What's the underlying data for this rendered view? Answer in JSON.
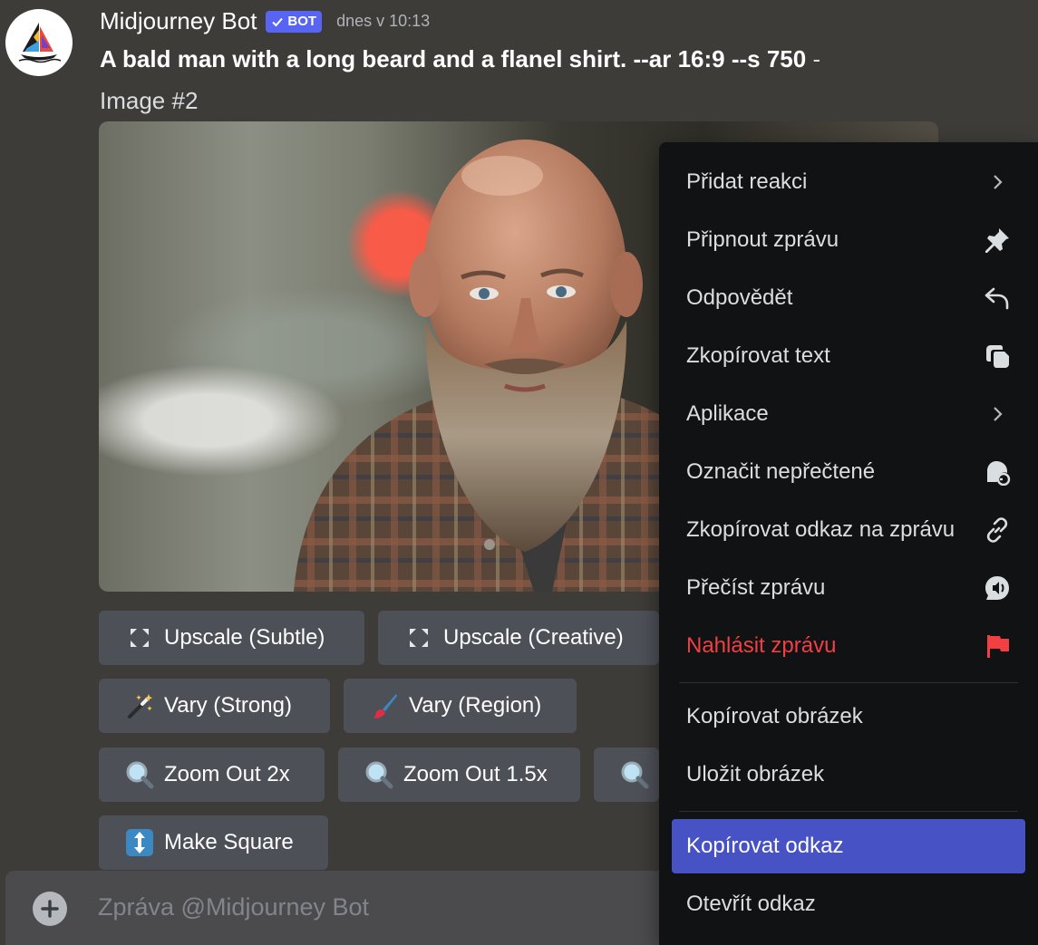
{
  "message": {
    "author": "Midjourney Bot",
    "badge": "BOT",
    "timestamp": "dnes v 10:13",
    "prompt_bold": "A bald man with a long beard and a flanel shirt. --ar 16:9 --s 750",
    "prompt_suffix": " -",
    "image_label": "Image #2"
  },
  "buttons": {
    "upscale_subtle": "Upscale (Subtle)",
    "upscale_creative": "Upscale (Creative)",
    "vary_strong": "Vary (Strong)",
    "vary_region": "Vary (Region)",
    "zoom_out_2x": "Zoom Out 2x",
    "zoom_out_15x": "Zoom Out 1.5x",
    "make_square": "Make Square"
  },
  "composer": {
    "placeholder": "Zpráva @Midjourney Bot",
    "value": ""
  },
  "context_menu": {
    "items": [
      {
        "label": "Přidat reakci",
        "icon": "chevron-right-icon"
      },
      {
        "label": "Připnout zprávu",
        "icon": "pin-icon"
      },
      {
        "label": "Odpovědět",
        "icon": "reply-icon"
      },
      {
        "label": "Zkopírovat text",
        "icon": "copy-text-icon"
      },
      {
        "label": "Aplikace",
        "icon": "chevron-right-icon"
      },
      {
        "label": "Označit nepřečtené",
        "icon": "mark-unread-icon"
      },
      {
        "label": "Zkopírovat odkaz na zprávu",
        "icon": "link-icon"
      },
      {
        "label": "Přečíst zprávu",
        "icon": "speaker-icon"
      },
      {
        "label": "Nahlásit zprávu",
        "icon": "flag-icon"
      },
      {
        "label": "Kopírovat obrázek"
      },
      {
        "label": "Uložit obrázek"
      },
      {
        "label": "Kopírovat odkaz"
      },
      {
        "label": "Otevřít odkaz"
      }
    ],
    "selected_item": "Kopírovat odkaz"
  },
  "colors": {
    "background": "#3e3c39",
    "menu_background": "#111214",
    "selected": "#4752c4",
    "danger": "#f23f42",
    "bot_badge": "#5865f2",
    "button": "#4e5058"
  }
}
